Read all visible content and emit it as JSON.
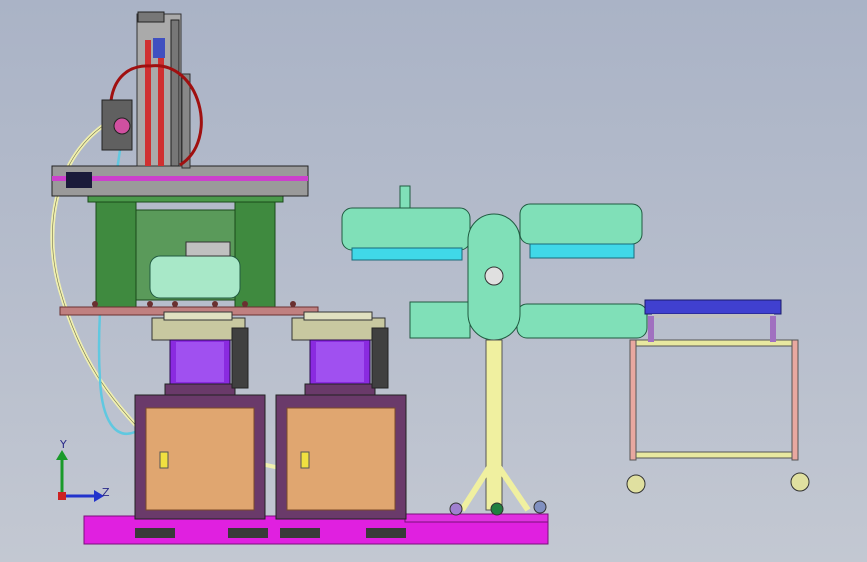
{
  "viewport": {
    "background_top": "#aab3c6",
    "background_bottom": "#c3c8d2"
  },
  "triad": {
    "y_label": "Y",
    "z_label": "Z",
    "y_color": "#1a9a2a",
    "z_color": "#2233cc",
    "x_color": "#cc2222"
  },
  "colors": {
    "base_magenta": "#e020e0",
    "cabinet_frame": "#6a3a6a",
    "cabinet_door": "#e0a670",
    "bowl_purple": "#8a2ae0",
    "bowl_top": "#c8c8a0",
    "frame_green": "#3f8a3f",
    "plate_rose": "#c08080",
    "arm_mint": "#80e0b8",
    "arm_cyan": "#40d8e8",
    "post_yellow": "#f0f0a0",
    "cart_blue": "#4040d0",
    "cart_pink": "#e8a8a0",
    "gantry_gray": "#a0a0a0",
    "cylinder_red": "#d03030",
    "hose_yellow": "#f0f0b0",
    "hose_blue": "#60c8e0",
    "hose_darkred": "#a01010"
  }
}
